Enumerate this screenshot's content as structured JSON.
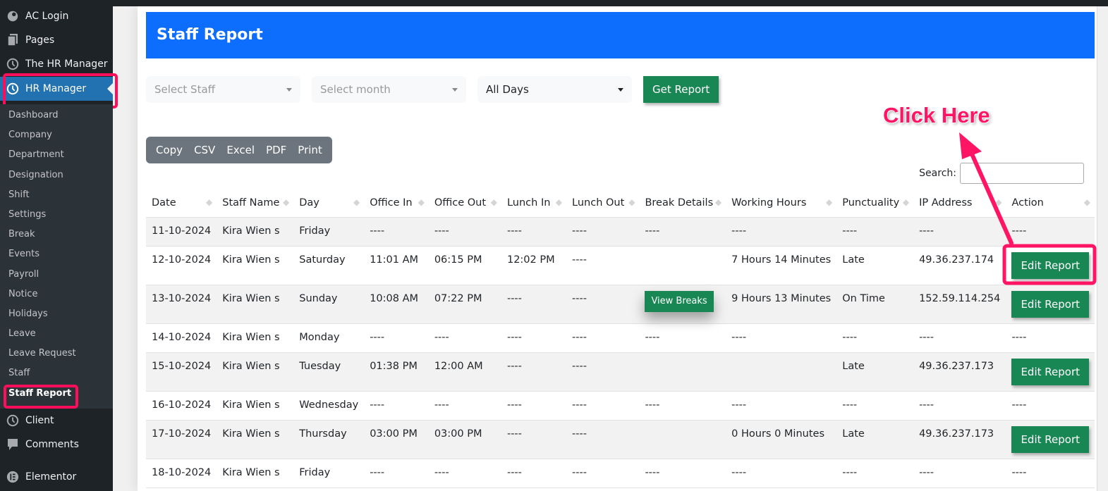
{
  "sidebar": {
    "top_items": [
      {
        "label": "AC Login",
        "icon": "ac-login-icon"
      },
      {
        "label": "Pages",
        "icon": "pages-icon"
      },
      {
        "label": "The HR Manager",
        "icon": "clock-icon"
      },
      {
        "label": "HR Manager",
        "icon": "clock-icon",
        "active": true
      }
    ],
    "submenu": [
      "Dashboard",
      "Company",
      "Department",
      "Designation",
      "Shift",
      "Settings",
      "Break",
      "Events",
      "Payroll",
      "Notice",
      "Holidays",
      "Leave",
      "Leave Request",
      "Staff",
      "Staff Report"
    ],
    "current_submenu": "Staff Report",
    "bottom_items": [
      {
        "label": "Client",
        "icon": "clock-icon"
      },
      {
        "label": "Comments",
        "icon": "comment-icon"
      },
      {
        "label": "Elementor",
        "icon": "elementor-icon"
      }
    ]
  },
  "page": {
    "title": "Staff Report",
    "accent_color": "#0d6efd"
  },
  "filters": {
    "staff_placeholder": "Select Staff",
    "month_placeholder": "Select month",
    "days_value": "All Days",
    "get_report_label": "Get Report"
  },
  "export_buttons": [
    "Copy",
    "CSV",
    "Excel",
    "PDF",
    "Print"
  ],
  "search": {
    "label": "Search:",
    "value": ""
  },
  "table": {
    "columns": [
      "Date",
      "Staff Name",
      "Day",
      "Office In",
      "Office Out",
      "Lunch In",
      "Lunch Out",
      "Break Details",
      "Working Hours",
      "Punctuality",
      "IP Address",
      "Action"
    ],
    "rows": [
      {
        "date": "11-10-2024",
        "staff": "Kira Wien s",
        "day": "Friday",
        "office_in": "----",
        "office_out": "----",
        "lunch_in": "----",
        "lunch_out": "----",
        "break": "----",
        "hours": "----",
        "punctuality": "----",
        "ip": "----",
        "action": "----"
      },
      {
        "date": "12-10-2024",
        "staff": "Kira Wien s",
        "day": "Saturday",
        "office_in": "11:01 AM",
        "office_out": "06:15 PM",
        "lunch_in": "12:02 PM",
        "lunch_out": "----",
        "break": "",
        "hours": "7 Hours 14 Minutes",
        "punctuality": "Late",
        "ip": "49.36.237.174",
        "action_button": "Edit Report"
      },
      {
        "date": "13-10-2024",
        "staff": "Kira Wien s",
        "day": "Sunday",
        "office_in": "10:08 AM",
        "office_out": "07:22 PM",
        "lunch_in": "----",
        "lunch_out": "----",
        "break_button": "View Breaks",
        "hours": "9 Hours 13 Minutes",
        "punctuality": "On Time",
        "ip": "152.59.114.254",
        "action_button": "Edit Report"
      },
      {
        "date": "14-10-2024",
        "staff": "Kira Wien s",
        "day": "Monday",
        "office_in": "----",
        "office_out": "----",
        "lunch_in": "----",
        "lunch_out": "----",
        "break": "----",
        "hours": "----",
        "punctuality": "----",
        "ip": "----",
        "action": "----"
      },
      {
        "date": "15-10-2024",
        "staff": "Kira Wien s",
        "day": "Tuesday",
        "office_in": "01:38 PM",
        "office_out": "12:00 AM",
        "lunch_in": "----",
        "lunch_out": "----",
        "break": "",
        "hours": "",
        "punctuality": "Late",
        "ip": "49.36.237.173",
        "action_button": "Edit Report"
      },
      {
        "date": "16-10-2024",
        "staff": "Kira Wien s",
        "day": "Wednesday",
        "office_in": "----",
        "office_out": "----",
        "lunch_in": "----",
        "lunch_out": "----",
        "break": "----",
        "hours": "----",
        "punctuality": "----",
        "ip": "----",
        "action": "----"
      },
      {
        "date": "17-10-2024",
        "staff": "Kira Wien s",
        "day": "Thursday",
        "office_in": "03:00 PM",
        "office_out": "03:00 PM",
        "lunch_in": "----",
        "lunch_out": "----",
        "break": "",
        "hours": "0 Hours 0 Minutes",
        "punctuality": "Late",
        "ip": "49.36.237.173",
        "action_button": "Edit Report"
      },
      {
        "date": "18-10-2024",
        "staff": "Kira Wien s",
        "day": "Friday",
        "office_in": "----",
        "office_out": "----",
        "lunch_in": "----",
        "lunch_out": "----",
        "break": "----",
        "hours": "----",
        "punctuality": "----",
        "ip": "----",
        "action": "----"
      }
    ]
  },
  "annotation": {
    "text": "Click Here",
    "color": "#ff1564"
  }
}
